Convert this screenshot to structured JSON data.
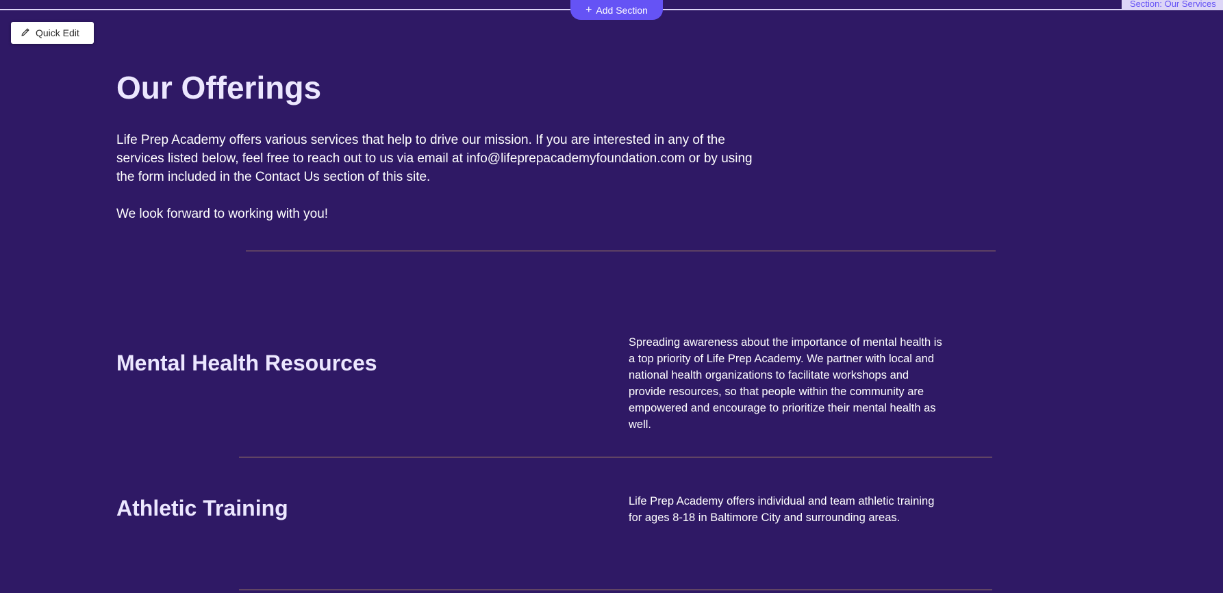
{
  "editor": {
    "add_section_label": "Add Section",
    "section_label": "Section: Our Services",
    "quick_edit_label": "Quick Edit"
  },
  "page": {
    "title": "Our Offerings",
    "intro_paragraph": "Life Prep Academy offers various services that help to drive our mission. If you are interested in any of the services listed below, feel free to reach out to us via email at info@lifeprepacademyfoundation.com or by using the form included in the Contact Us section of this site.",
    "closing_line": "We look forward to working with you!"
  },
  "offerings": [
    {
      "title": "Mental Health Resources",
      "description": "Spreading awareness about the importance of mental health is a top priority of Life Prep Academy. We partner with local and national health organizations to facilitate workshops and provide resources, so that people within the community are empowered and encourage to prioritize their mental health as well."
    },
    {
      "title": "Athletic Training",
      "description": "Life Prep Academy offers individual and team athletic training for ages 8-18 in Baltimore City and surrounding areas."
    }
  ],
  "colors": {
    "background": "#2f1965",
    "editor_accent": "#6553f5",
    "divider": "#b08a62",
    "heading_text": "#ece7ff"
  }
}
